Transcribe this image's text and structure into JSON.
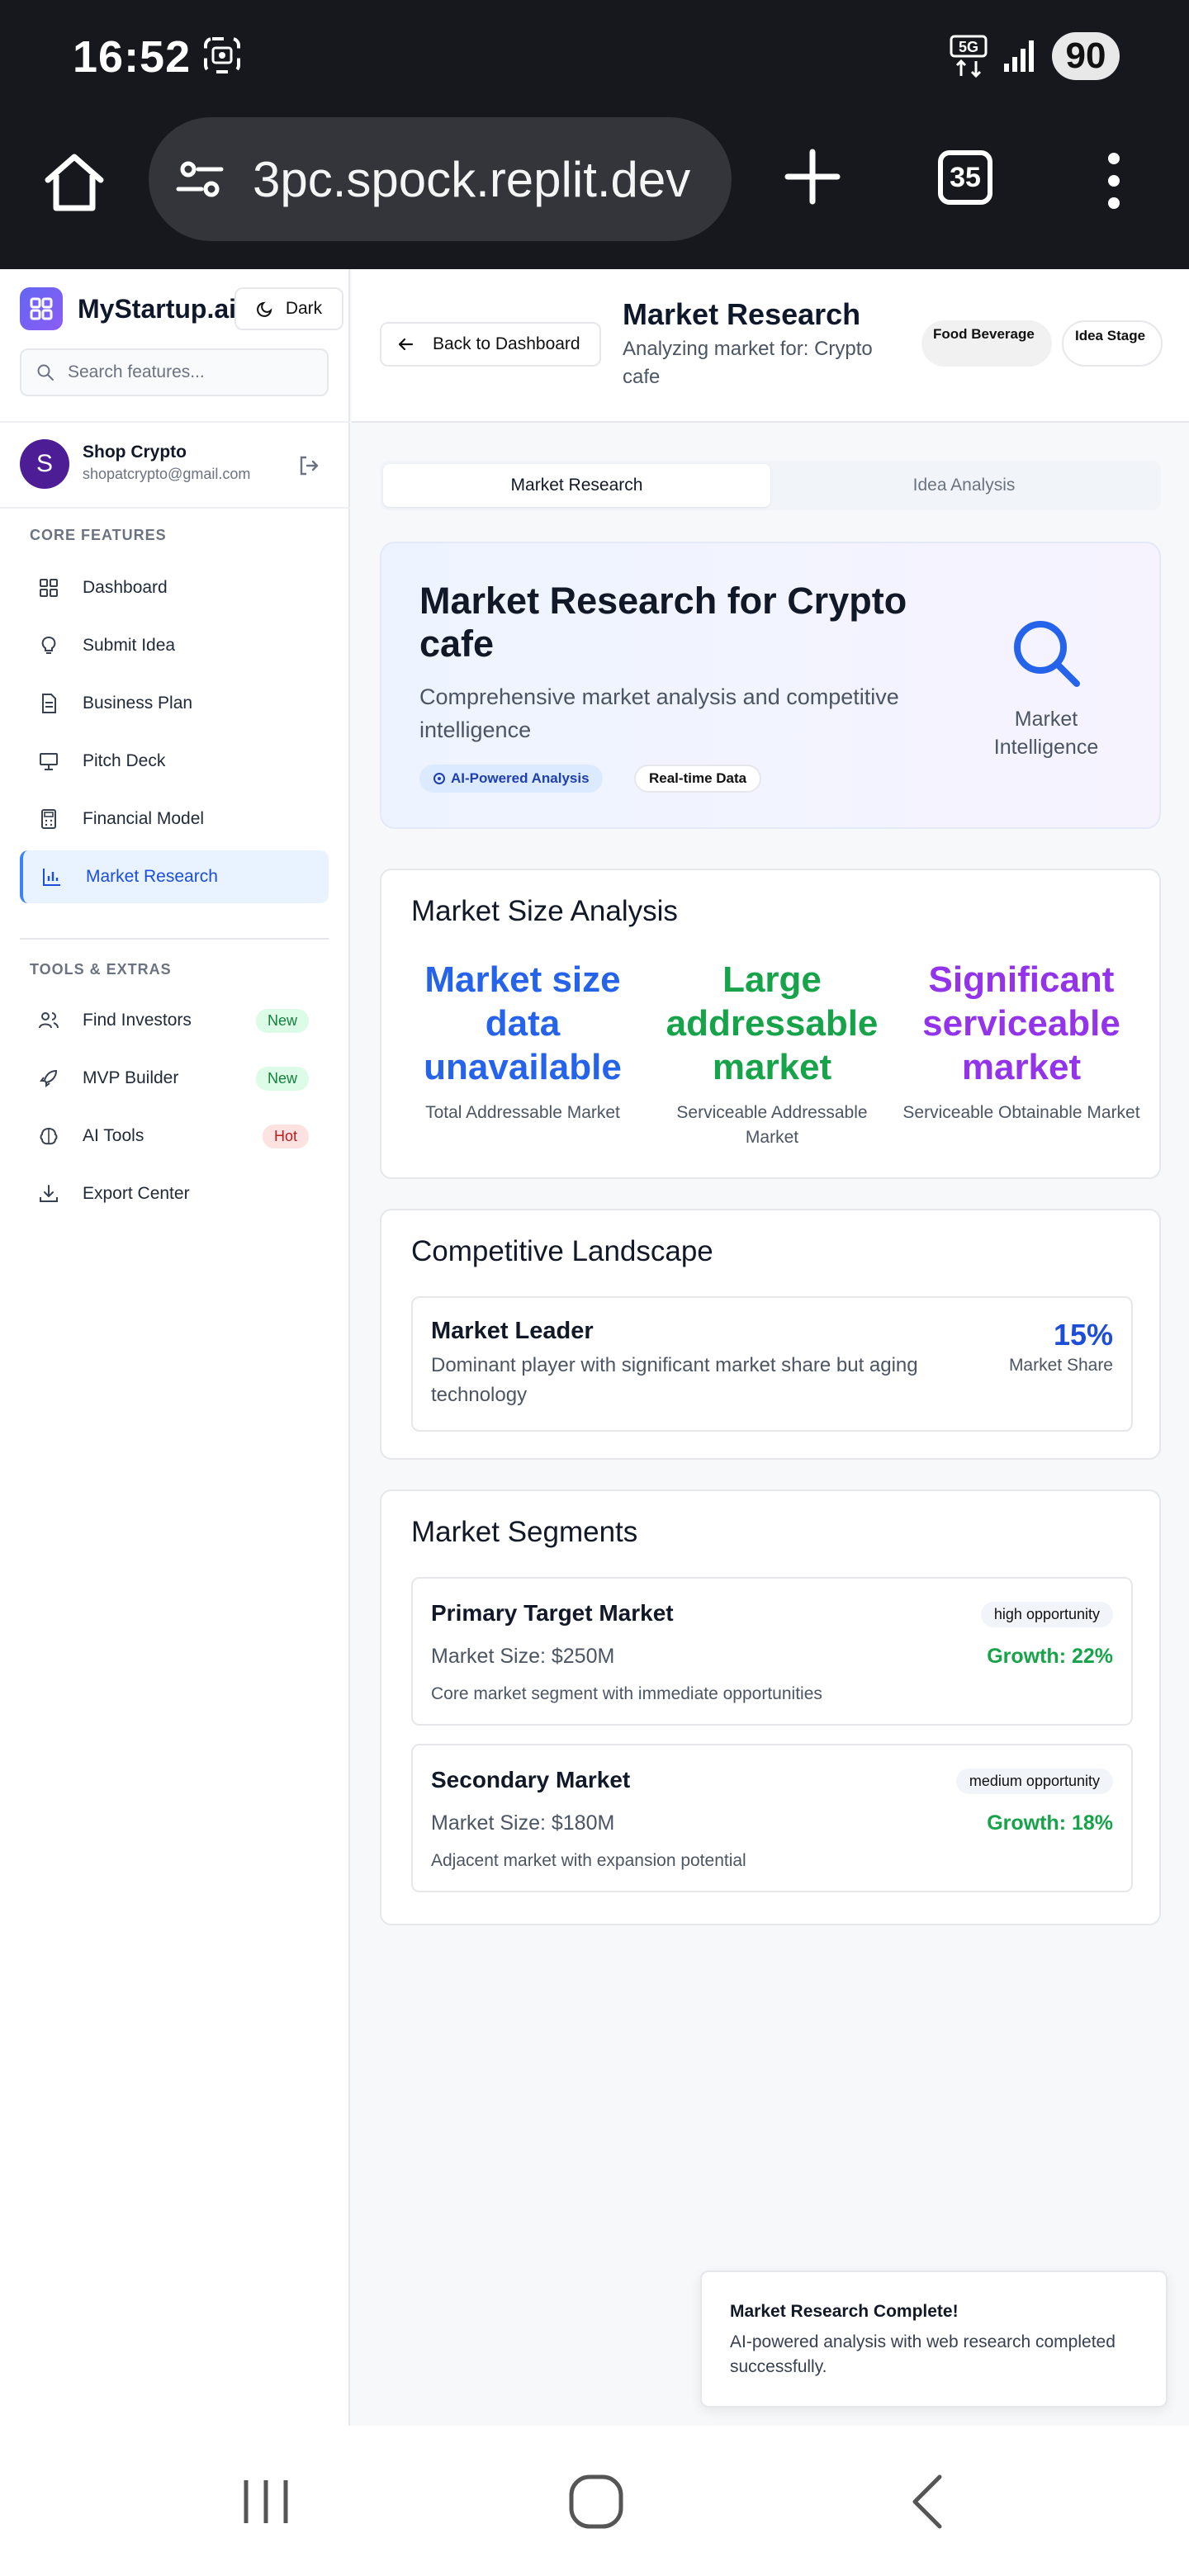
{
  "status": {
    "time": "16:52",
    "network": "5G",
    "battery": "90"
  },
  "browser": {
    "url": "3pc.spock.replit.dev",
    "tab_count": "35"
  },
  "sidebar": {
    "brand": "MyStartup.ai",
    "theme_toggle": "Dark",
    "search_placeholder": "Search features...",
    "user": {
      "initial": "S",
      "name": "Shop Crypto",
      "email": "shopatcrypto@gmail.com"
    },
    "core_label": "CORE FEATURES",
    "core_items": [
      {
        "label": "Dashboard",
        "icon": "grid-icon"
      },
      {
        "label": "Submit Idea",
        "icon": "lightbulb-icon"
      },
      {
        "label": "Business Plan",
        "icon": "document-icon"
      },
      {
        "label": "Pitch Deck",
        "icon": "presentation-icon"
      },
      {
        "label": "Financial Model",
        "icon": "calculator-icon"
      },
      {
        "label": "Market Research",
        "icon": "bar-chart-icon",
        "active": true
      }
    ],
    "tools_label": "TOOLS & EXTRAS",
    "tools_items": [
      {
        "label": "Find Investors",
        "icon": "users-icon",
        "badge": "New"
      },
      {
        "label": "MVP Builder",
        "icon": "rocket-icon",
        "badge": "New"
      },
      {
        "label": "AI Tools",
        "icon": "brain-icon",
        "badge": "Hot"
      },
      {
        "label": "Export Center",
        "icon": "download-icon"
      }
    ]
  },
  "header": {
    "back_label": "Back to Dashboard",
    "title": "Market Research",
    "subtitle": "Analyzing market for: Crypto cafe",
    "tag_industry": "Food Beverage",
    "tag_stage": "Idea Stage"
  },
  "tabs": [
    "Market Research",
    "Idea Analysis"
  ],
  "hero": {
    "title": "Market Research for Crypto cafe",
    "subtitle": "Comprehensive market analysis and competitive intelligence",
    "pill_ai": "AI-Powered Analysis",
    "pill_realtime": "Real-time Data",
    "icon_label": "Market Intelligence"
  },
  "market_size": {
    "title": "Market Size Analysis",
    "tam": {
      "value": "Market size data unavailable",
      "label": "Total Addressable Market",
      "color": "#2563eb"
    },
    "sam": {
      "value": "Large addressable market",
      "label": "Serviceable Addressable Market",
      "color": "#16a34a"
    },
    "som": {
      "value": "Significant serviceable market",
      "label": "Serviceable Obtainable Market",
      "color": "#9333ea"
    }
  },
  "competitive": {
    "title": "Competitive Landscape",
    "competitors": [
      {
        "name": "Market Leader",
        "description": "Dominant player with significant market share but aging technology",
        "share": "15%",
        "share_label": "Market Share"
      }
    ]
  },
  "segments": {
    "title": "Market Segments",
    "items": [
      {
        "name": "Primary Target Market",
        "badge": "high opportunity",
        "size": "Market Size: $250M",
        "growth": "Growth: 22%",
        "description": "Core market segment with immediate opportunities"
      },
      {
        "name": "Secondary Market",
        "badge": "medium opportunity",
        "size": "Market Size: $180M",
        "growth": "Growth: 18%",
        "description": "Adjacent market with expansion potential"
      }
    ]
  },
  "toast": {
    "title": "Market Research Complete!",
    "body": "AI-powered analysis with web research completed successfully."
  }
}
